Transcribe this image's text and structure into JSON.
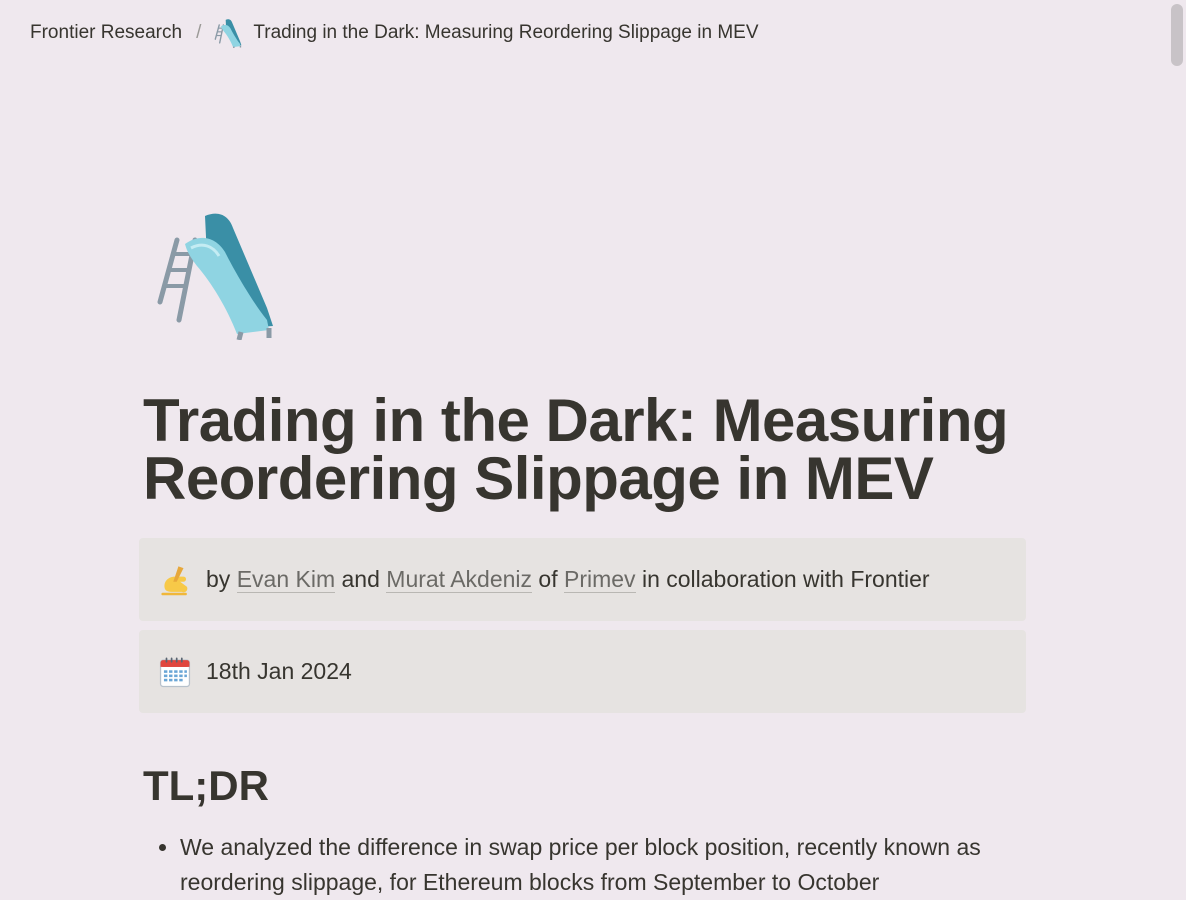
{
  "breadcrumb": {
    "root": "Frontier Research",
    "separator": "/",
    "current_icon": "slide-icon",
    "current": "Trading in the Dark: Measuring Reordering Slippage in MEV"
  },
  "page": {
    "icon": "slide-icon",
    "title": "Trading in the Dark: Measuring Reordering Slippage in MEV"
  },
  "authors_callout": {
    "icon": "writing-hand-icon",
    "prefix": "by",
    "author1": "Evan Kim",
    "conj": "and",
    "author2": "Murat Akdeniz",
    "of": "of",
    "org": "Primev",
    "suffix": "in collaboration with Frontier"
  },
  "date_callout": {
    "icon": "calendar-icon",
    "date": "18th Jan 2024"
  },
  "tldr": {
    "heading": "TL;DR",
    "bullets": [
      "We analyzed the difference in swap price per block position, recently known as reordering slippage, for Ethereum blocks from September to October"
    ]
  },
  "colors": {
    "background": "#efe8ee",
    "callout_bg": "#e6e3e1",
    "text": "#37352f",
    "link": "#6b6a66"
  }
}
